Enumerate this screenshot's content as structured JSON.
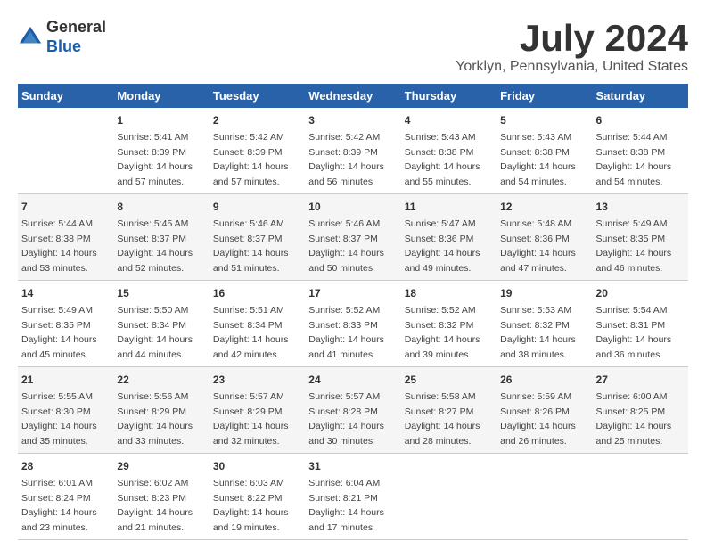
{
  "logo": {
    "general": "General",
    "blue": "Blue"
  },
  "title": "July 2024",
  "subtitle": "Yorklyn, Pennsylvania, United States",
  "header_days": [
    "Sunday",
    "Monday",
    "Tuesday",
    "Wednesday",
    "Thursday",
    "Friday",
    "Saturday"
  ],
  "weeks": [
    [
      {
        "day": "",
        "detail": ""
      },
      {
        "day": "1",
        "detail": "Sunrise: 5:41 AM\nSunset: 8:39 PM\nDaylight: 14 hours\nand 57 minutes."
      },
      {
        "day": "2",
        "detail": "Sunrise: 5:42 AM\nSunset: 8:39 PM\nDaylight: 14 hours\nand 57 minutes."
      },
      {
        "day": "3",
        "detail": "Sunrise: 5:42 AM\nSunset: 8:39 PM\nDaylight: 14 hours\nand 56 minutes."
      },
      {
        "day": "4",
        "detail": "Sunrise: 5:43 AM\nSunset: 8:38 PM\nDaylight: 14 hours\nand 55 minutes."
      },
      {
        "day": "5",
        "detail": "Sunrise: 5:43 AM\nSunset: 8:38 PM\nDaylight: 14 hours\nand 54 minutes."
      },
      {
        "day": "6",
        "detail": "Sunrise: 5:44 AM\nSunset: 8:38 PM\nDaylight: 14 hours\nand 54 minutes."
      }
    ],
    [
      {
        "day": "7",
        "detail": "Sunrise: 5:44 AM\nSunset: 8:38 PM\nDaylight: 14 hours\nand 53 minutes."
      },
      {
        "day": "8",
        "detail": "Sunrise: 5:45 AM\nSunset: 8:37 PM\nDaylight: 14 hours\nand 52 minutes."
      },
      {
        "day": "9",
        "detail": "Sunrise: 5:46 AM\nSunset: 8:37 PM\nDaylight: 14 hours\nand 51 minutes."
      },
      {
        "day": "10",
        "detail": "Sunrise: 5:46 AM\nSunset: 8:37 PM\nDaylight: 14 hours\nand 50 minutes."
      },
      {
        "day": "11",
        "detail": "Sunrise: 5:47 AM\nSunset: 8:36 PM\nDaylight: 14 hours\nand 49 minutes."
      },
      {
        "day": "12",
        "detail": "Sunrise: 5:48 AM\nSunset: 8:36 PM\nDaylight: 14 hours\nand 47 minutes."
      },
      {
        "day": "13",
        "detail": "Sunrise: 5:49 AM\nSunset: 8:35 PM\nDaylight: 14 hours\nand 46 minutes."
      }
    ],
    [
      {
        "day": "14",
        "detail": "Sunrise: 5:49 AM\nSunset: 8:35 PM\nDaylight: 14 hours\nand 45 minutes."
      },
      {
        "day": "15",
        "detail": "Sunrise: 5:50 AM\nSunset: 8:34 PM\nDaylight: 14 hours\nand 44 minutes."
      },
      {
        "day": "16",
        "detail": "Sunrise: 5:51 AM\nSunset: 8:34 PM\nDaylight: 14 hours\nand 42 minutes."
      },
      {
        "day": "17",
        "detail": "Sunrise: 5:52 AM\nSunset: 8:33 PM\nDaylight: 14 hours\nand 41 minutes."
      },
      {
        "day": "18",
        "detail": "Sunrise: 5:52 AM\nSunset: 8:32 PM\nDaylight: 14 hours\nand 39 minutes."
      },
      {
        "day": "19",
        "detail": "Sunrise: 5:53 AM\nSunset: 8:32 PM\nDaylight: 14 hours\nand 38 minutes."
      },
      {
        "day": "20",
        "detail": "Sunrise: 5:54 AM\nSunset: 8:31 PM\nDaylight: 14 hours\nand 36 minutes."
      }
    ],
    [
      {
        "day": "21",
        "detail": "Sunrise: 5:55 AM\nSunset: 8:30 PM\nDaylight: 14 hours\nand 35 minutes."
      },
      {
        "day": "22",
        "detail": "Sunrise: 5:56 AM\nSunset: 8:29 PM\nDaylight: 14 hours\nand 33 minutes."
      },
      {
        "day": "23",
        "detail": "Sunrise: 5:57 AM\nSunset: 8:29 PM\nDaylight: 14 hours\nand 32 minutes."
      },
      {
        "day": "24",
        "detail": "Sunrise: 5:57 AM\nSunset: 8:28 PM\nDaylight: 14 hours\nand 30 minutes."
      },
      {
        "day": "25",
        "detail": "Sunrise: 5:58 AM\nSunset: 8:27 PM\nDaylight: 14 hours\nand 28 minutes."
      },
      {
        "day": "26",
        "detail": "Sunrise: 5:59 AM\nSunset: 8:26 PM\nDaylight: 14 hours\nand 26 minutes."
      },
      {
        "day": "27",
        "detail": "Sunrise: 6:00 AM\nSunset: 8:25 PM\nDaylight: 14 hours\nand 25 minutes."
      }
    ],
    [
      {
        "day": "28",
        "detail": "Sunrise: 6:01 AM\nSunset: 8:24 PM\nDaylight: 14 hours\nand 23 minutes."
      },
      {
        "day": "29",
        "detail": "Sunrise: 6:02 AM\nSunset: 8:23 PM\nDaylight: 14 hours\nand 21 minutes."
      },
      {
        "day": "30",
        "detail": "Sunrise: 6:03 AM\nSunset: 8:22 PM\nDaylight: 14 hours\nand 19 minutes."
      },
      {
        "day": "31",
        "detail": "Sunrise: 6:04 AM\nSunset: 8:21 PM\nDaylight: 14 hours\nand 17 minutes."
      },
      {
        "day": "",
        "detail": ""
      },
      {
        "day": "",
        "detail": ""
      },
      {
        "day": "",
        "detail": ""
      }
    ]
  ]
}
